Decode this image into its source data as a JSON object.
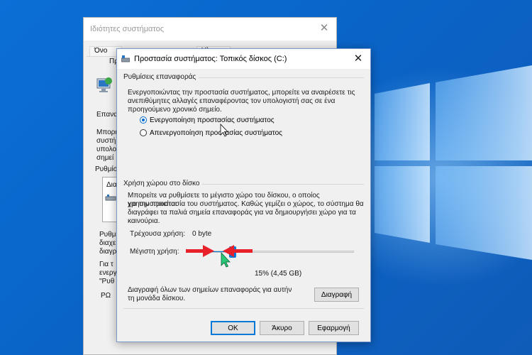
{
  "back_window": {
    "title": "Ιδιότητες συστήματος",
    "tabs": [
      "Όνο",
      "Υλ"
    ],
    "labels": {
      "pr": "Πρ",
      "epanaf": "Επαναφ",
      "body1": "Μπορεί",
      "body2": "συστή",
      "body3": "υπολο",
      "body4": "σημεί",
      "rythm": "Ρυθμίσ",
      "dia": "Δια",
      "rythm2": "Ρυθμ",
      "diaxe": "διαχε",
      "diagr": "διαγρ",
      "gia": "Για τ",
      "energ": "ενεργ",
      "quote": "\"Ρυθ",
      "po": "ΡΩ"
    }
  },
  "dialog": {
    "title": "Προστασία συστήματος: Τοπικός δίσκος (C:)",
    "restore_group": "Ρυθμίσεις επαναφοράς",
    "restore_desc": [
      "Ενεργοποιώντας την προστασία συστήματος, μπορείτε να αναιρέσετε τις",
      "ανεπιθύμητες αλλαγές επαναφέροντας τον υπολογιστή σας σε ένα",
      "προηγούμενο χρονικό σημείο."
    ],
    "radio_on": "Ενεργοποίηση προστασίας συστήματος",
    "radio_off": "Απενεργοποίηση προστασίας συστήματος",
    "disk_group": "Χρήση χώρου στο δίσκο",
    "disk_desc": [
      "Μπορείτε να ρυθμίσετε το μέγιστο χώρο του δίσκου, ο οποίος χρησιμοποιείται",
      "για την προστασία του συστήματος. Καθώς γεμίζει ο χώρος, το σύστημα θα",
      "διαγράφει τα παλιά σημεία επαναφοράς για να δημιουργήσει χώρο για τα",
      "καινούρια."
    ],
    "current_label": "Τρέχουσα χρήση:",
    "current_value": "0 byte",
    "max_label": "Μέγιστη χρήση:",
    "max_percent": 15,
    "max_text": "15% (4,45 GB)",
    "delete_desc": [
      "Διαγραφή όλων των σημείων επαναφοράς για αυτήν",
      "τη μονάδα δίσκου."
    ],
    "delete_btn": "Διαγραφή",
    "ok_btn": "OK",
    "cancel_btn": "Άκυρο",
    "apply_btn": "Εφαρμογή"
  },
  "colors": {
    "accent": "#0078d7",
    "arrow": "#e8202a"
  }
}
